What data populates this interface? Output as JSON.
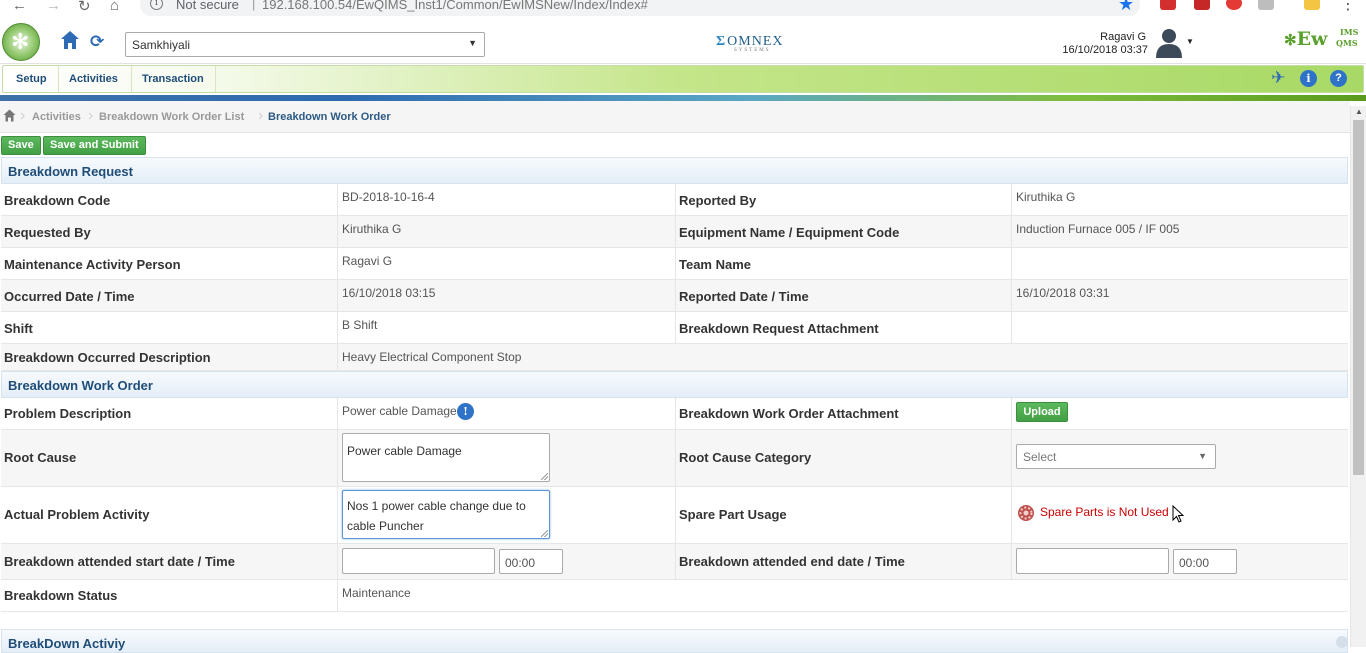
{
  "browser": {
    "security": "Not secure",
    "separator": "|",
    "url": "192.168.100.54/EwQIMS_Inst1/Common/EwIMSNew/Index/Index#"
  },
  "header": {
    "site": "Samkhiyali",
    "brand_center": "OMNEX",
    "brand_center_sub": "SYSTEMS",
    "user_name": "Ragavi G",
    "user_time": "16/10/2018 03:37",
    "brand_right": "Ew",
    "brand_right_ims": "IMS",
    "brand_right_qms": "QMS"
  },
  "menu": {
    "items": [
      "Setup",
      "Activities",
      "Transaction"
    ]
  },
  "breadcrumb": {
    "items": [
      "Activities",
      "Breakdown Work Order List",
      "Breakdown Work Order"
    ]
  },
  "toolbar": {
    "save_label": "Save",
    "save_submit_label": "Save and Submit"
  },
  "request": {
    "title": "Breakdown Request",
    "rows": [
      {
        "l1": "Breakdown Code",
        "v1": "BD-2018-10-16-4",
        "l2": "Reported By",
        "v2": "Kiruthika G"
      },
      {
        "l1": "Requested By",
        "v1": "Kiruthika G",
        "l2": "Equipment Name / Equipment Code",
        "v2": "Induction Furnace 005 / IF 005"
      },
      {
        "l1": "Maintenance Activity Person",
        "v1": "Ragavi G",
        "l2": "Team Name",
        "v2": ""
      },
      {
        "l1": "Occurred Date / Time",
        "v1": "16/10/2018 03:15",
        "l2": "Reported Date / Time",
        "v2": "16/10/2018 03:31"
      },
      {
        "l1": "Shift",
        "v1": "B Shift",
        "l2": "Breakdown Request Attachment",
        "v2": ""
      }
    ],
    "description_label": "Breakdown Occurred Description",
    "description_value": "Heavy Electrical Component Stop"
  },
  "workorder": {
    "title": "Breakdown Work Order",
    "problem_label": "Problem Description",
    "problem_value": "Power cable Damage",
    "attachment_label": "Breakdown Work Order Attachment",
    "upload_label": "Upload",
    "root_cause_label": "Root Cause",
    "root_cause_value": "Power cable Damage",
    "root_cause_category_label": "Root Cause Category",
    "root_cause_category_value": "Select",
    "actual_label": "Actual Problem Activity",
    "actual_line1": "Nos 1 power cable change due to",
    "actual_line2": "cable  Puncher",
    "spare_label": "Spare Part Usage",
    "spare_value": "Spare Parts is Not Used",
    "start_label": "Breakdown attended start date / Time",
    "start_date": "",
    "start_time": "00:00",
    "end_label": "Breakdown attended end date / Time",
    "end_date": "",
    "end_time": "00:00",
    "status_label": "Breakdown Status",
    "status_value": "Maintenance"
  },
  "activity": {
    "title": "BreakDown Activiy"
  }
}
